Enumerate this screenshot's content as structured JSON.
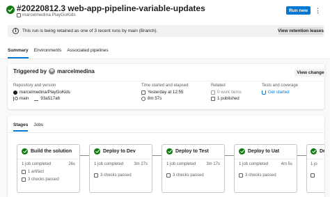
{
  "header": {
    "title": "#20220812.3 web-app-pipeline-variable-updates",
    "repo": "marcelmedina.PlayGoKids",
    "run_button": "Run new",
    "more_icon": "kebab-icon",
    "status_color": "#107c10"
  },
  "banner": {
    "text": "This run is being retained as one of 3 recent runs by main (Branch).",
    "button": "View retention leases"
  },
  "tabs": [
    "Summary",
    "Environments",
    "Associated pipelines"
  ],
  "summary": {
    "triggered_by_prefix": "Triggered by",
    "user": "marcelmedina",
    "view_change": "View change",
    "repo_label": "Repository and version",
    "repo_name": "marcelmedina/PlayGoKids",
    "branch": "main",
    "commit": "93a517a6",
    "time_label": "Time started and elapsed",
    "started": "Yesterday at 12:55",
    "elapsed": "8m 57s",
    "related_label": "Related",
    "work_items": "0 work items",
    "published": "1 published",
    "tests_label": "Tests and coverage",
    "tests_link": "Get started"
  },
  "stages_tabs": [
    "Stages",
    "Jobs"
  ],
  "stages": [
    {
      "name": "Build the solution",
      "jobs": "1 job completed",
      "duration": "26s",
      "extra": "1 artifact",
      "checks": "3 checks passed"
    },
    {
      "name": "Deploy to Dev",
      "jobs": "1 job completed",
      "duration": "3m 27s",
      "extra": "",
      "checks": "3 checks passed"
    },
    {
      "name": "Deploy to Test",
      "jobs": "1 job completed",
      "duration": "3m 17s",
      "extra": "",
      "checks": "3 checks passed"
    },
    {
      "name": "Deploy to Uat",
      "jobs": "1 job completed",
      "duration": "4m 5s",
      "extra": "",
      "checks": "3 checks passed"
    },
    {
      "name": "De",
      "jobs": "1 jo",
      "duration": "",
      "extra": "",
      "checks": ""
    }
  ],
  "colors": {
    "accent": "#0078d4",
    "success": "#107c10"
  }
}
